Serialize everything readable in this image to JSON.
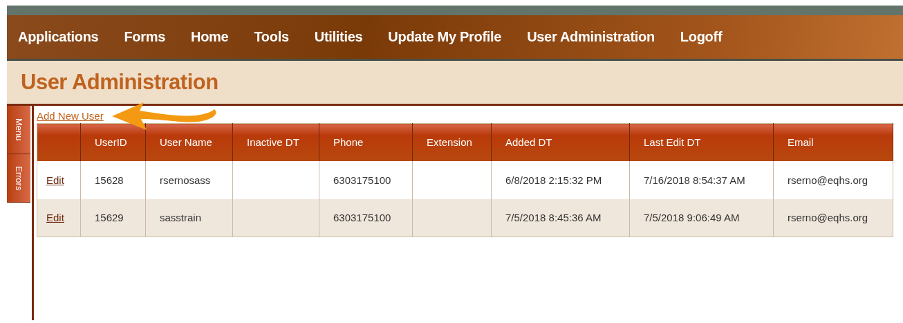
{
  "nav": {
    "items": [
      "Applications",
      "Forms",
      "Home",
      "Tools",
      "Utilities",
      "Update My Profile",
      "User Administration",
      "Logoff"
    ]
  },
  "page_title": "User Administration",
  "side_tabs": [
    "Menu",
    "Errors"
  ],
  "add_link": "Add New User",
  "table": {
    "columns": [
      "UserID",
      "User Name",
      "Inactive DT",
      "Phone",
      "Extension",
      "Added DT",
      "Last Edit DT",
      "Email"
    ],
    "rows": [
      {
        "action": "Edit",
        "user_id": "15628",
        "user_name": "rsernosass",
        "phone": "6303175100",
        "added_dt": "6/8/2018 2:15:32 PM",
        "last_edit_dt": "7/16/2018 8:54:37 AM",
        "email": "rserno@eqhs.org"
      },
      {
        "action": "Edit",
        "user_id": "15629",
        "user_name": "sasstrain",
        "phone": "6303175100",
        "added_dt": "7/5/2018 8:45:36 AM",
        "last_edit_dt": "7/5/2018 9:06:49 AM",
        "email": "rserno@eqhs.org"
      }
    ]
  }
}
